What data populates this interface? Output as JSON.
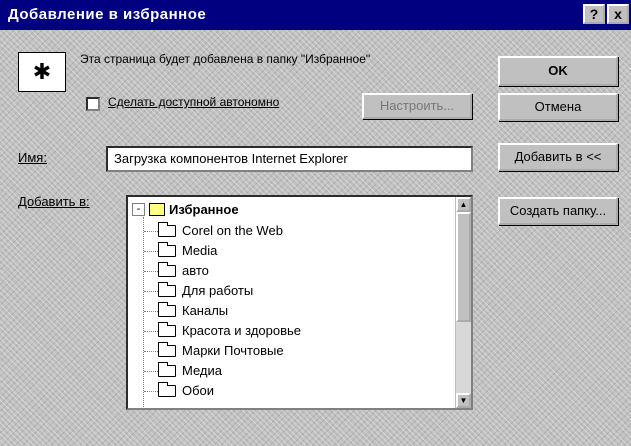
{
  "window": {
    "title": "Добавление в избранное",
    "help_label": "?",
    "close_label": "x"
  },
  "info": {
    "icon_glyph": "✱",
    "message": "Эта страница будет добавлена в папку \"Избранное\"",
    "checkbox_label": "Сделать доступной автономно",
    "checkbox_checked": false,
    "settings_label": "Настроить..."
  },
  "buttons": {
    "ok": "OK",
    "cancel": "Отмена",
    "add_to": "Добавить в <<",
    "new_folder": "Создать папку..."
  },
  "form": {
    "name_label": "Имя:",
    "name_value": "Загрузка компонентов Internet Explorer",
    "addto_label": "Добавить в:"
  },
  "tree": {
    "expander": "-",
    "root": "Избранное",
    "items": [
      "Corel on the Web",
      "Media",
      "авто",
      "Для работы",
      "Каналы",
      "Красота и здоровье",
      "Марки Почтовые",
      "Медиа",
      "Обои"
    ]
  },
  "colors": {
    "titlebar": "#000080",
    "face": "#c0c0c0"
  }
}
